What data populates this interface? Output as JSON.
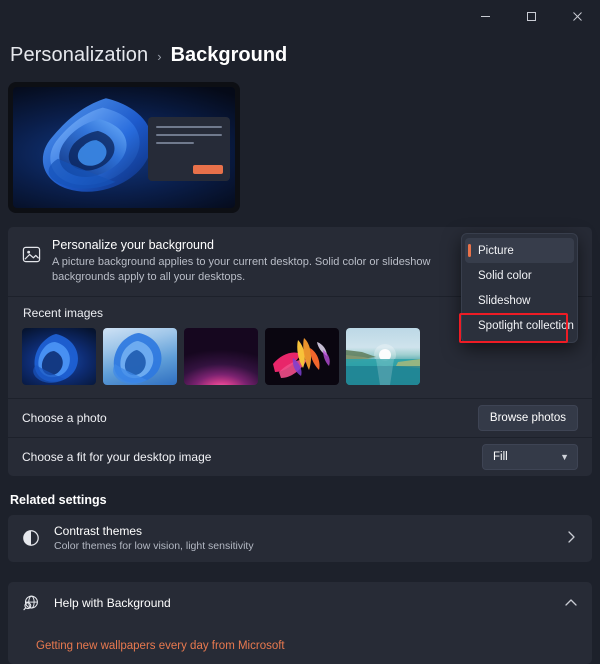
{
  "window": {
    "controls": [
      {
        "name": "minimize",
        "glyph": "minimize-icon"
      },
      {
        "name": "maximize",
        "glyph": "maximize-icon"
      },
      {
        "name": "close",
        "glyph": "close-icon"
      }
    ]
  },
  "breadcrumb": {
    "parent": "Personalization",
    "separator": "›",
    "current": "Background"
  },
  "preview": {
    "name": "desktop-preview",
    "wallpaper": "windows-11-bloom-blue"
  },
  "personalize": {
    "icon": "image-icon",
    "title": "Personalize your background",
    "description": "A picture background applies to your current desktop. Solid color or slideshow backgrounds apply to all your desktops.",
    "dropdown": {
      "selected": "Picture",
      "open": true,
      "options": [
        "Picture",
        "Solid color",
        "Slideshow",
        "Spotlight collection"
      ],
      "highlighted_option": "Spotlight collection"
    }
  },
  "recent_images": {
    "label": "Recent images",
    "thumbnails": [
      {
        "name": "bloom-dark-blue"
      },
      {
        "name": "bloom-light-blue"
      },
      {
        "name": "purple-glow-arc"
      },
      {
        "name": "colorful-abstract-flower"
      },
      {
        "name": "sunset-lagoon-landscape"
      }
    ]
  },
  "choose_photo": {
    "label": "Choose a photo",
    "button": "Browse photos"
  },
  "choose_fit": {
    "label": "Choose a fit for your desktop image",
    "value": "Fill",
    "chevron": "chevron-down-icon"
  },
  "related_settings": {
    "title": "Related settings",
    "items": [
      {
        "icon": "contrast-icon",
        "title": "Contrast themes",
        "subtitle": "Color themes for low vision, light sensitivity",
        "chevron": "chevron-right-icon"
      }
    ]
  },
  "help": {
    "icon": "help-globe-icon",
    "title": "Help with Background",
    "chevron": "chevron-up-icon",
    "expanded": true,
    "links": [
      "Getting new wallpapers every day from Microsoft"
    ]
  },
  "colors": {
    "page_background": "#1d212b",
    "card_background": "#272b36",
    "accent_orange": "#e8724a",
    "annotation_red": "#ee1c25",
    "link_orange": "#e8794f"
  }
}
